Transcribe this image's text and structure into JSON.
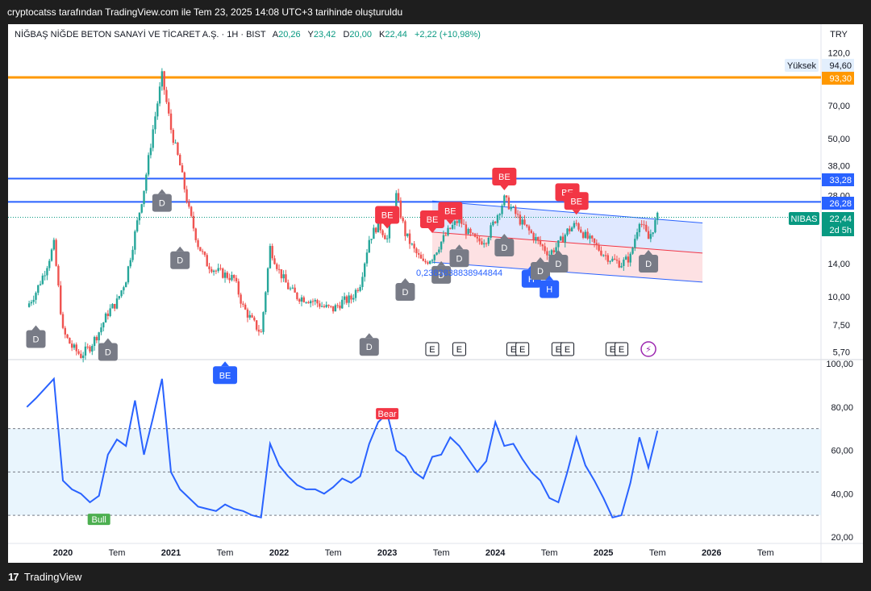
{
  "app": {
    "snapshot_caption": "cryptocatss tarafından TradingView.com ile Tem 23, 2025 14:08 UTC+3 tarihinde oluşturuldu",
    "brand": "TradingView"
  },
  "symbol_header": {
    "name": "NİĞBAŞ NİĞDE BETON SANAYİ VE TİCARET A.Ş. · 1H · BIST",
    "open_label": "A",
    "open": "20,26",
    "high_label": "Y",
    "high": "23,42",
    "low_label": "D",
    "low": "20,00",
    "close_label": "K",
    "close": "22,44",
    "change": "+2,22 (+10,98%)",
    "currency": "TRY"
  },
  "price_badges": {
    "high_label": "Yüksek",
    "high_value": "94,60",
    "level_1": "93,30",
    "level_2": "33,28",
    "level_3": "26,28",
    "ticker": "NIBAS",
    "last": "22,44",
    "countdown": "2d 5h"
  },
  "overlay_text": {
    "regression_value": "0,2383838838944844"
  },
  "colors": {
    "up": "#26a69a",
    "down": "#ef5350",
    "resistance": "#2962ff",
    "top_level": "#ff9800",
    "badge_d": "#787b86",
    "badge_be_red": "#f23645",
    "badge_be_blue": "#2962ff",
    "oscillator": "#2962ff",
    "oscillator_band": "#e3f2fd"
  },
  "chart_data": [
    {
      "type": "candlestick",
      "scale": "log",
      "y_tick_labels": [
        "120,0",
        "70,00",
        "50,00",
        "38,00",
        "28,00",
        "14,00",
        "10,00",
        "7,50",
        "5,70"
      ],
      "x_tick_labels": [
        "2020",
        "Tem",
        "2021",
        "Tem",
        "2022",
        "Tem",
        "2023",
        "Tem",
        "2024",
        "Tem",
        "2025",
        "Tem",
        "2026",
        "Tem"
      ],
      "horizontal_levels": [
        93.3,
        33.28,
        26.28
      ],
      "approx_close_path": [
        {
          "x": "2019-09",
          "y": 9.0
        },
        {
          "x": "2019-10",
          "y": 10.5
        },
        {
          "x": "2019-11",
          "y": 13.0
        },
        {
          "x": "2019-12",
          "y": 17.0
        },
        {
          "x": "2020-01",
          "y": 7.0
        },
        {
          "x": "2020-02",
          "y": 6.0
        },
        {
          "x": "2020-03",
          "y": 5.5
        },
        {
          "x": "2020-04",
          "y": 6.0
        },
        {
          "x": "2020-05",
          "y": 7.0
        },
        {
          "x": "2020-06",
          "y": 8.5
        },
        {
          "x": "2020-07",
          "y": 9.5
        },
        {
          "x": "2020-08",
          "y": 12.0
        },
        {
          "x": "2020-09",
          "y": 19.0
        },
        {
          "x": "2020-10",
          "y": 30.0
        },
        {
          "x": "2020-11",
          "y": 55.0
        },
        {
          "x": "2020-12",
          "y": 94.6
        },
        {
          "x": "2021-01",
          "y": 55.0
        },
        {
          "x": "2021-02",
          "y": 38.0
        },
        {
          "x": "2021-03",
          "y": 24.0
        },
        {
          "x": "2021-04",
          "y": 17.0
        },
        {
          "x": "2021-05",
          "y": 14.0
        },
        {
          "x": "2021-06",
          "y": 13.0
        },
        {
          "x": "2021-07",
          "y": 12.5
        },
        {
          "x": "2021-08",
          "y": 12.0
        },
        {
          "x": "2021-09",
          "y": 9.0
        },
        {
          "x": "2021-10",
          "y": 7.8
        },
        {
          "x": "2021-11",
          "y": 6.9
        },
        {
          "x": "2021-12",
          "y": 16.5
        },
        {
          "x": "2022-01",
          "y": 13.0
        },
        {
          "x": "2022-02",
          "y": 11.0
        },
        {
          "x": "2022-03",
          "y": 10.0
        },
        {
          "x": "2022-04",
          "y": 9.8
        },
        {
          "x": "2022-05",
          "y": 9.5
        },
        {
          "x": "2022-06",
          "y": 9.0
        },
        {
          "x": "2022-07",
          "y": 8.8
        },
        {
          "x": "2022-08",
          "y": 9.5
        },
        {
          "x": "2022-09",
          "y": 9.8
        },
        {
          "x": "2022-10",
          "y": 11.5
        },
        {
          "x": "2022-11",
          "y": 18.0
        },
        {
          "x": "2022-12",
          "y": 21.0
        },
        {
          "x": "2023-01",
          "y": 18.0
        },
        {
          "x": "2023-02",
          "y": 28.0
        },
        {
          "x": "2023-03",
          "y": 19.0
        },
        {
          "x": "2023-04",
          "y": 16.0
        },
        {
          "x": "2023-05",
          "y": 14.0
        },
        {
          "x": "2023-06",
          "y": 15.0
        },
        {
          "x": "2023-07",
          "y": 17.5
        },
        {
          "x": "2023-08",
          "y": 20.0
        },
        {
          "x": "2023-09",
          "y": 22.0
        },
        {
          "x": "2023-10",
          "y": 19.0
        },
        {
          "x": "2023-11",
          "y": 17.5
        },
        {
          "x": "2023-12",
          "y": 18.0
        },
        {
          "x": "2024-01",
          "y": 22.0
        },
        {
          "x": "2024-02",
          "y": 27.0
        },
        {
          "x": "2024-03",
          "y": 24.0
        },
        {
          "x": "2024-04",
          "y": 21.0
        },
        {
          "x": "2024-05",
          "y": 19.0
        },
        {
          "x": "2024-06",
          "y": 17.0
        },
        {
          "x": "2024-07",
          "y": 15.5
        },
        {
          "x": "2024-08",
          "y": 17.0
        },
        {
          "x": "2024-09",
          "y": 19.5
        },
        {
          "x": "2024-10",
          "y": 21.0
        },
        {
          "x": "2024-11",
          "y": 18.5
        },
        {
          "x": "2024-12",
          "y": 17.0
        },
        {
          "x": "2025-01",
          "y": 15.5
        },
        {
          "x": "2025-02",
          "y": 14.5
        },
        {
          "x": "2025-03",
          "y": 14.0
        },
        {
          "x": "2025-04",
          "y": 15.0
        },
        {
          "x": "2025-05",
          "y": 22.0
        },
        {
          "x": "2025-06",
          "y": 18.0
        },
        {
          "x": "2025-07",
          "y": 22.44
        }
      ],
      "signal_markers": [
        {
          "label": "D",
          "x": "2019-10",
          "y": 6.5,
          "color": "grey"
        },
        {
          "label": "D",
          "x": "2020-06",
          "y": 5.7,
          "color": "grey"
        },
        {
          "label": "D",
          "x": "2020-12",
          "y": 26.0,
          "color": "grey"
        },
        {
          "label": "D",
          "x": "2021-02",
          "y": 14.5,
          "color": "grey"
        },
        {
          "label": "BE",
          "x": "2021-07",
          "y": 4.5,
          "color": "blue"
        },
        {
          "label": "D",
          "x": "2022-11",
          "y": 6.0,
          "color": "grey"
        },
        {
          "label": "BE",
          "x": "2023-01",
          "y": 23.0,
          "color": "red"
        },
        {
          "label": "D",
          "x": "2023-03",
          "y": 10.5,
          "color": "grey"
        },
        {
          "label": "BE",
          "x": "2023-06",
          "y": 22.0,
          "color": "red"
        },
        {
          "label": "D",
          "x": "2023-07",
          "y": 12.5,
          "color": "grey"
        },
        {
          "label": "BE",
          "x": "2023-08",
          "y": 24.0,
          "color": "red"
        },
        {
          "label": "D",
          "x": "2023-09",
          "y": 14.8,
          "color": "grey"
        },
        {
          "label": "BE",
          "x": "2024-02",
          "y": 34.0,
          "color": "red"
        },
        {
          "label": "D",
          "x": "2024-02",
          "y": 16.5,
          "color": "grey"
        },
        {
          "label": "H",
          "x": "2024-05",
          "y": 12.0,
          "color": "blue"
        },
        {
          "label": "D",
          "x": "2024-06",
          "y": 13.0,
          "color": "grey"
        },
        {
          "label": "H",
          "x": "2024-07",
          "y": 10.8,
          "color": "blue"
        },
        {
          "label": "D",
          "x": "2024-08",
          "y": 14.0,
          "color": "grey"
        },
        {
          "label": "BE",
          "x": "2024-09",
          "y": 29.0,
          "color": "red"
        },
        {
          "label": "BE",
          "x": "2024-10",
          "y": 26.5,
          "color": "red"
        },
        {
          "label": "D",
          "x": "2025-06",
          "y": 14.0,
          "color": "grey"
        }
      ],
      "event_markers": [
        {
          "label": "E",
          "x": "2023-06"
        },
        {
          "label": "E",
          "x": "2023-09"
        },
        {
          "label": "E",
          "x": "2024-03"
        },
        {
          "label": "E",
          "x": "2024-04"
        },
        {
          "label": "E",
          "x": "2024-08"
        },
        {
          "label": "E",
          "x": "2024-09"
        },
        {
          "label": "E",
          "x": "2025-02"
        },
        {
          "label": "E",
          "x": "2025-03"
        },
        {
          "label": "⚡",
          "x": "2025-06"
        }
      ],
      "regression_channel": {
        "x_start": "2023-06",
        "x_end": "2025-12",
        "upper_start": 26.5,
        "upper_end": 21.2,
        "mid_start": 19.3,
        "mid_end": 15.6,
        "lower_start": 14.2,
        "lower_end": 11.6
      }
    },
    {
      "type": "line",
      "ylim": [
        20,
        100
      ],
      "y_tick_labels": [
        "100,00",
        "80,00",
        "60,00",
        "40,00",
        "20,00"
      ],
      "band": [
        30,
        70
      ],
      "mid_line": 50,
      "annotations": [
        {
          "label": "Bull",
          "x": "2020-05",
          "y": 30
        },
        {
          "label": "Bear",
          "x": "2023-01",
          "y": 78
        }
      ],
      "x": [
        "2019-09",
        "2019-10",
        "2019-12",
        "2020-01",
        "2020-02",
        "2020-03",
        "2020-04",
        "2020-05",
        "2020-06",
        "2020-07",
        "2020-08",
        "2020-09",
        "2020-10",
        "2020-11",
        "2020-12",
        "2021-01",
        "2021-02",
        "2021-03",
        "2021-04",
        "2021-05",
        "2021-06",
        "2021-07",
        "2021-08",
        "2021-09",
        "2021-10",
        "2021-11",
        "2021-12",
        "2022-01",
        "2022-02",
        "2022-03",
        "2022-04",
        "2022-05",
        "2022-06",
        "2022-07",
        "2022-08",
        "2022-09",
        "2022-10",
        "2022-11",
        "2022-12",
        "2023-01",
        "2023-02",
        "2023-03",
        "2023-04",
        "2023-05",
        "2023-06",
        "2023-07",
        "2023-08",
        "2023-09",
        "2023-10",
        "2023-11",
        "2023-12",
        "2024-01",
        "2024-02",
        "2024-03",
        "2024-04",
        "2024-05",
        "2024-06",
        "2024-07",
        "2024-08",
        "2024-09",
        "2024-10",
        "2024-11",
        "2024-12",
        "2025-01",
        "2025-02",
        "2025-03",
        "2025-04",
        "2025-05",
        "2025-06",
        "2025-07"
      ],
      "values": [
        80,
        84,
        93,
        46,
        42,
        40,
        36,
        39,
        58,
        65,
        62,
        83,
        58,
        75,
        93,
        50,
        42,
        38,
        34,
        33,
        32,
        35,
        33,
        32,
        30,
        29,
        63,
        53,
        48,
        44,
        42,
        42,
        40,
        43,
        47,
        45,
        48,
        63,
        73,
        77,
        60,
        57,
        50,
        47,
        57,
        58,
        66,
        62,
        56,
        50,
        55,
        73,
        62,
        63,
        56,
        50,
        46,
        38,
        36,
        50,
        66,
        53,
        46,
        38,
        29,
        30,
        45,
        66,
        52,
        69
      ]
    }
  ]
}
